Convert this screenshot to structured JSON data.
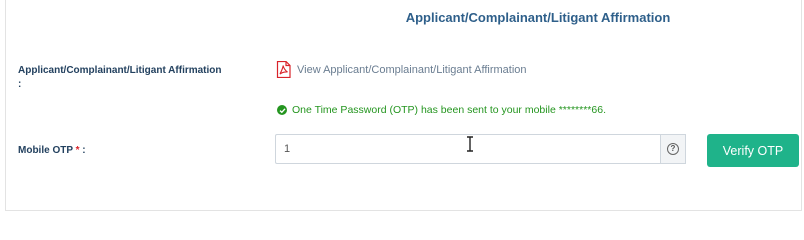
{
  "section": {
    "heading": "Applicant/Complainant/Litigant Affirmation"
  },
  "affirmation": {
    "label": "Applicant/Complainant/Litigant Affirmation",
    "label_suffix": ":",
    "link_text": "View Applicant/Complainant/Litigant Affirmation",
    "link_icon": "pdf-icon"
  },
  "otp": {
    "status_message": "One Time Password (OTP) has been sent to your mobile ********66.",
    "status_icon": "check-circle-icon",
    "label": "Mobile OTP",
    "required_mark": "*",
    "label_suffix": " :",
    "input_value": "1",
    "help_icon": "question-circle-icon",
    "verify_button_label": "Verify OTP"
  },
  "colors": {
    "heading": "#2e5f8a",
    "success": "#24951f",
    "button": "#1fb38a",
    "required": "#d9232a"
  }
}
